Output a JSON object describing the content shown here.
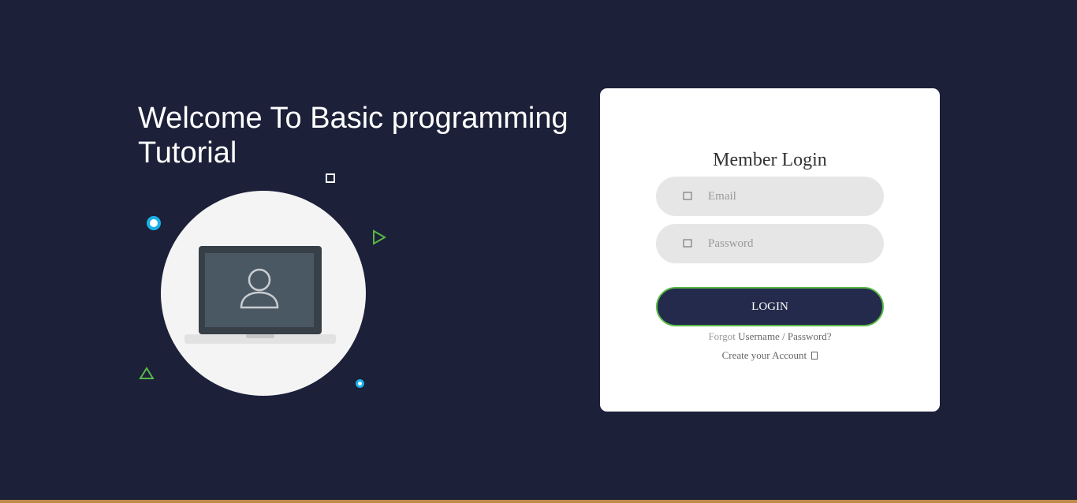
{
  "welcome": {
    "title_line1": "Welcome To Basic programming",
    "title_line2": "Tutorial"
  },
  "illustration": {
    "center_icon": "user-icon",
    "decorations": [
      "ring-icon",
      "square-icon",
      "triangle-right-icon",
      "triangle-up-icon",
      "dot-icon"
    ]
  },
  "login_form": {
    "heading": "Member Login",
    "email_placeholder": "Email",
    "password_placeholder": "Password",
    "email_icon": "envelope-icon",
    "password_icon": "lock-icon",
    "login_label": "LOGIN",
    "forgot_prefix": "Forgot",
    "forgot_link": "Username / Password?",
    "create_account": "Create your Account",
    "create_icon": "arrow-right-icon"
  },
  "colors": {
    "background": "#1c2039",
    "card": "#ffffff",
    "button": "#232a4b",
    "button_border": "#57b846",
    "accent_blue": "#1ab0e8",
    "accent_green": "#57b846"
  }
}
